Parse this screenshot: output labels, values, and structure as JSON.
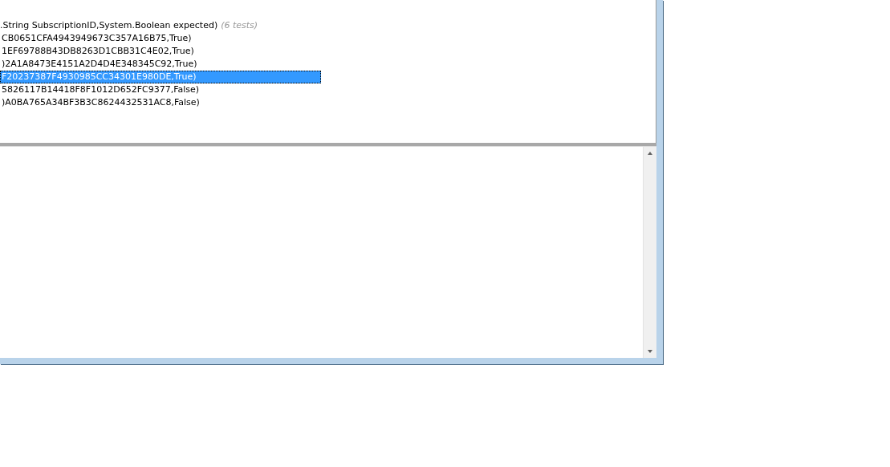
{
  "tree": {
    "header": {
      "label": ".String SubscriptionID,System.Boolean expected)",
      "count": "(6 tests)"
    },
    "rows": [
      {
        "label": "CB0651CFA4943949673C357A16B75,True)",
        "selected": false
      },
      {
        "label": "1EF69788B43DB8263D1CBB31C4E02,True)",
        "selected": false
      },
      {
        "label": ")2A1A8473E4151A2D4D4E348345C92,True)",
        "selected": false
      },
      {
        "label": "F20237387F4930985CC34301E980DE,True)",
        "selected": true
      },
      {
        "label": "5826117B14418F8F1012D652FC9377,False)",
        "selected": false
      },
      {
        "label": ")A0BA765A34BF3B3C8624432531AC8,False)",
        "selected": false
      }
    ]
  }
}
